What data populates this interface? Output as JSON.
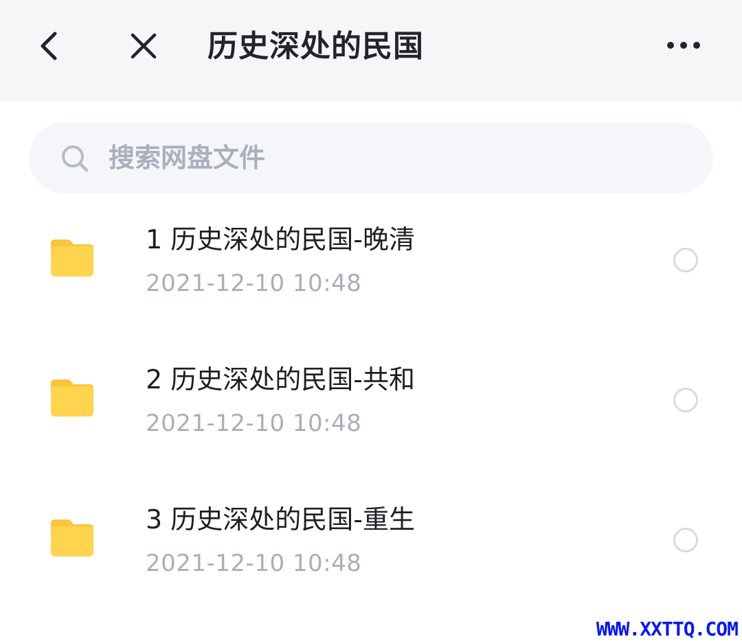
{
  "header": {
    "back_icon": "chevron-left-icon",
    "close_icon": "close-icon",
    "title": "历史深处的民国",
    "more_icon": "more-horizontal-icon"
  },
  "search": {
    "icon": "search-icon",
    "placeholder": "搜索网盘文件",
    "value": ""
  },
  "files": [
    {
      "icon": "folder-icon",
      "name": "1 历史深处的民国-晚清",
      "date": "2021-12-10",
      "time": "10:48",
      "datetime": "2021-12-10  10:48"
    },
    {
      "icon": "folder-icon",
      "name": "2 历史深处的民国-共和",
      "date": "2021-12-10",
      "time": "10:48",
      "datetime": "2021-12-10  10:48"
    },
    {
      "icon": "folder-icon",
      "name": "3 历史深处的民国-重生",
      "date": "2021-12-10",
      "time": "10:48",
      "datetime": "2021-12-10  10:48"
    }
  ],
  "watermark": "WWW.XXTTQ.COM",
  "colors": {
    "header_bg": "#f5f6f7",
    "search_bg": "#f4f6f9",
    "placeholder": "#aab0bb",
    "folder": "#ffd44f",
    "folder_tab": "#f7c63c",
    "secondary_text": "#a9afb9",
    "watermark": "#0a19e8"
  }
}
